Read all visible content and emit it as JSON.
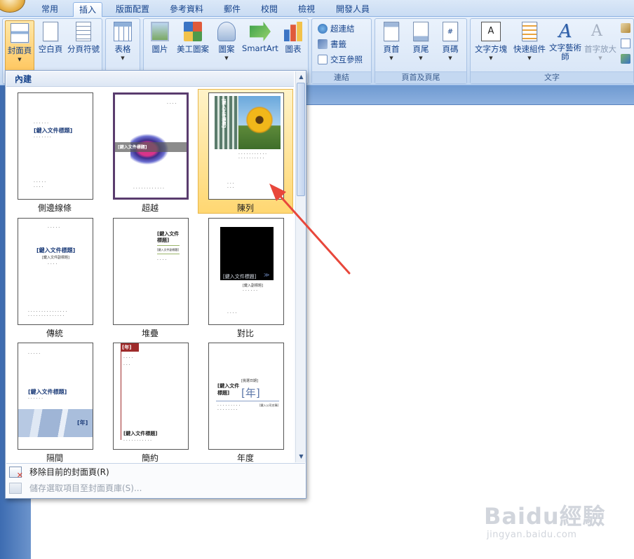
{
  "tabs": [
    "常用",
    "插入",
    "版面配置",
    "參考資料",
    "郵件",
    "校閱",
    "檢視",
    "開發人員"
  ],
  "active_tab": "插入",
  "ribbon": {
    "pages": {
      "buttons": [
        "封面頁",
        "空白頁",
        "分頁符號"
      ],
      "label": ""
    },
    "table": {
      "button": "表格"
    },
    "illustrations": {
      "buttons": [
        "圖片",
        "美工圖案",
        "圖案",
        "SmartArt",
        "圖表"
      ]
    },
    "links": {
      "buttons": [
        "超連結",
        "書籤",
        "交互參照"
      ],
      "label": "連結"
    },
    "header_footer": {
      "buttons": [
        "頁首",
        "頁尾",
        "頁碼"
      ],
      "label": "頁首及頁尾"
    },
    "text": {
      "buttons": [
        "文字方塊",
        "快速組件",
        "文字藝術師",
        "首字放大"
      ],
      "label": "文字"
    }
  },
  "gallery": {
    "header": "內建",
    "items": [
      {
        "label": "側邊線條",
        "title": "[鍵入文件標題]"
      },
      {
        "label": "超越",
        "title": "[鍵入文件標題]"
      },
      {
        "label": "陳列",
        "title": "[鍵入文件標題]",
        "selected": true
      },
      {
        "label": "傳統",
        "title": "[鍵入文件標題]",
        "subtitle": "[鍵入文件副標題]"
      },
      {
        "label": "堆疊",
        "title": "[鍵入文件標題]",
        "subtitle": "[鍵入文件副標題]"
      },
      {
        "label": "對比",
        "title": "[鍵入文件標題]",
        "subtitle": "[鍵入副標題]"
      },
      {
        "label": "隔間",
        "title": "[鍵入文件標題]",
        "year": "[年]"
      },
      {
        "label": "簡約",
        "title": "[鍵入文件標題]",
        "year": "[年]"
      },
      {
        "label": "年度",
        "title": "[鍵入文件標題]",
        "year": "[年]",
        "date": "[挑選日期]",
        "company": "[鍵入公司名稱]"
      }
    ]
  },
  "menu": {
    "remove": "移除目前的封面頁(R)",
    "save": "儲存選取項目至封面頁庫(S)..."
  },
  "watermark": {
    "brand": "Baidu經驗",
    "url": "jingyan.baidu.com"
  },
  "colors": {
    "accent": "#e8473b",
    "ribbon": "#d1e1f5",
    "selected": "#ffd772"
  }
}
